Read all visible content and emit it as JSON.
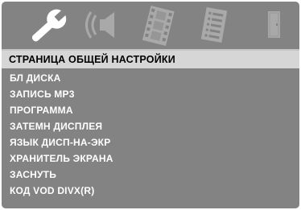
{
  "tabs": [
    {
      "icon": "wrench-icon",
      "active": true
    },
    {
      "icon": "speaker-icon",
      "active": false
    },
    {
      "icon": "film-icon",
      "active": false
    },
    {
      "icon": "document-icon",
      "active": false
    },
    {
      "icon": "door-icon",
      "active": false
    }
  ],
  "page_title": "СТРАНИЦА ОБЩЕЙ НАСТРОЙКИ",
  "menu_items": [
    "БЛ ДИСКА",
    "ЗАПИСЬ MP3",
    "ПРОГРАММА",
    "ЗАТЕМН ДИСПЛЕЯ",
    "ЯЗЫК ДИСП-НА-ЭКР",
    "ХРАНИТЕЛЬ ЭКРАНА",
    "ЗАСНУТЬ",
    "КОД VOD DIVX(R)"
  ],
  "colors": {
    "panel": "#838383",
    "header_bg": "#d6d6d6",
    "active_icon": "#ffffff",
    "inactive_icon": "#a9a9a9",
    "menu_text": "#ffffff"
  }
}
